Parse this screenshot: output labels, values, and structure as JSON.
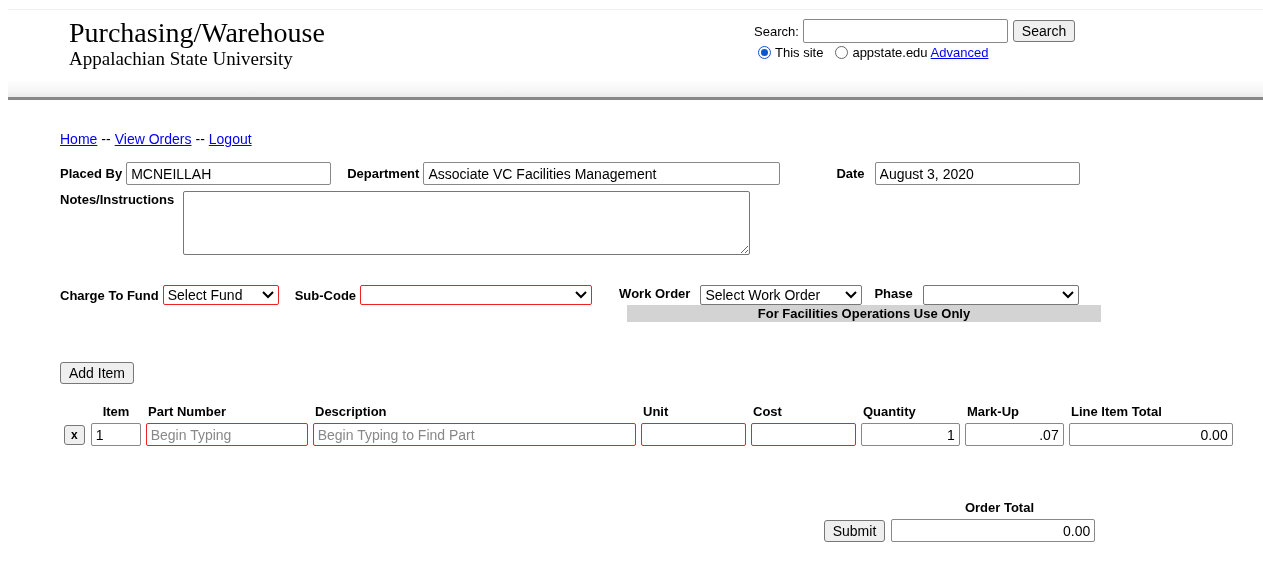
{
  "header": {
    "title": "Purchasing/Warehouse",
    "subtitle": "Appalachian State University"
  },
  "search": {
    "label": "Search:",
    "button": "Search",
    "scopes": [
      {
        "label": "This site",
        "selected": true
      },
      {
        "label": "appstate.edu",
        "selected": false
      }
    ],
    "advanced": "Advanced"
  },
  "nav": {
    "links": [
      "Home",
      "View Orders",
      "Logout"
    ],
    "separator": "--"
  },
  "order": {
    "placed_by": {
      "label": "Placed By",
      "value": "MCNEILLAH"
    },
    "department": {
      "label": "Department",
      "value": "Associate VC Facilities Management"
    },
    "date": {
      "label": "Date",
      "value": "August 3, 2020"
    },
    "notes": {
      "label": "Notes/Instructions"
    }
  },
  "charge": {
    "fund": {
      "label": "Charge To Fund",
      "value": "Select Fund",
      "required": true
    },
    "sub_code": {
      "label": "Sub-Code",
      "required": true
    },
    "work_order": {
      "label": "Work Order",
      "value": "Select Work Order",
      "required": false
    },
    "phase": {
      "label": "Phase",
      "required": false
    },
    "note": "For Facilities Operations Use Only"
  },
  "add_item": "Add Item",
  "items": {
    "columns": [
      "Item",
      "Part Number",
      "Description",
      "Unit",
      "Cost",
      "Quantity",
      "Mark-Up",
      "Line Item Total"
    ],
    "rows": [
      {
        "remove": "x",
        "cells": [
          {
            "value": "1",
            "required": false,
            "kind": "text"
          },
          {
            "placeholder": "Begin Typing",
            "required": true,
            "kind": "text"
          },
          {
            "placeholder": "Begin Typing to Find Part",
            "required": true,
            "kind": "text"
          },
          {
            "required": true,
            "kind": "text"
          },
          {
            "required": true,
            "kind": "text"
          },
          {
            "value": "1",
            "required": false,
            "kind": "number"
          },
          {
            "value": ".07",
            "required": false,
            "kind": "number"
          },
          {
            "value": "0.00",
            "required": false,
            "kind": "number"
          }
        ]
      }
    ]
  },
  "total": {
    "label": "Order Total",
    "submit": "Submit",
    "value": "0.00"
  }
}
